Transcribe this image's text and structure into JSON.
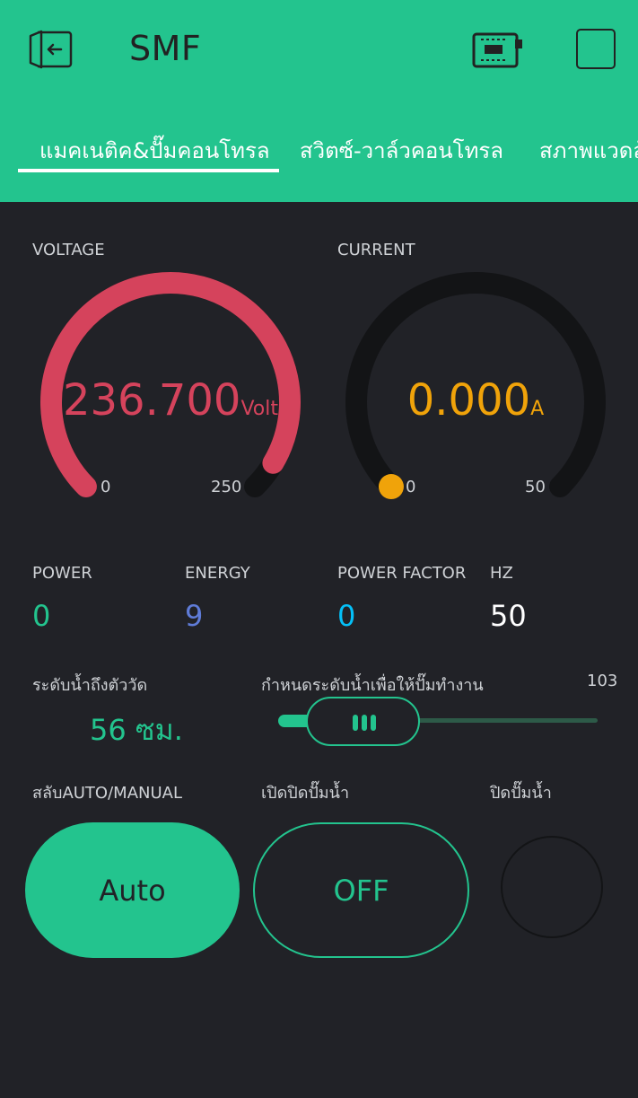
{
  "app": {
    "title": "SMF"
  },
  "header": {
    "exit_icon": "exit-icon",
    "device_icon": "device-chip-icon",
    "square_icon": "square-icon"
  },
  "tabs": [
    {
      "label": "แมคเนติค&ปั๊มคอนโทรล",
      "active": true
    },
    {
      "label": "สวิตซ์-วาล์วคอนโทรล",
      "active": false
    },
    {
      "label": "สภาพแวดล้",
      "active": false
    }
  ],
  "voltage": {
    "label": "VOLTAGE",
    "value": "236.700",
    "unit": "Volt",
    "min": "0",
    "max": "250",
    "level": 236.7,
    "color": "#d5435c"
  },
  "current": {
    "label": "CURRENT",
    "value": "0.000",
    "unit": "A",
    "min": "0",
    "max": "50",
    "level": 0,
    "color": "#f0a30a"
  },
  "power": {
    "label": "POWER",
    "value": "0",
    "color": "#23c48e"
  },
  "energy": {
    "label": "ENERGY",
    "value": "9",
    "color": "#5f7cd8"
  },
  "power_factor": {
    "label": "POWER FACTOR",
    "value": "0",
    "color": "#04c0f8"
  },
  "hz": {
    "label": "HZ",
    "value": "50",
    "color": "#ffffff"
  },
  "water_level": {
    "label": "ระดับน้ำถึงตัววัด",
    "value": "56 ซม.",
    "color": "#23c48e"
  },
  "pump_threshold": {
    "label": "กำหนดระดับน้ำเพื่อให้ปั๊มทำงาน",
    "value": "103"
  },
  "mode_switch": {
    "label": "สลับAUTO/MANUAL",
    "button": "Auto"
  },
  "pump_toggle": {
    "label": "เปิดปิดปั๊มน้ำ",
    "button": "OFF"
  },
  "pump_off_led": {
    "label": "ปิดปั๊มน้ำ"
  }
}
